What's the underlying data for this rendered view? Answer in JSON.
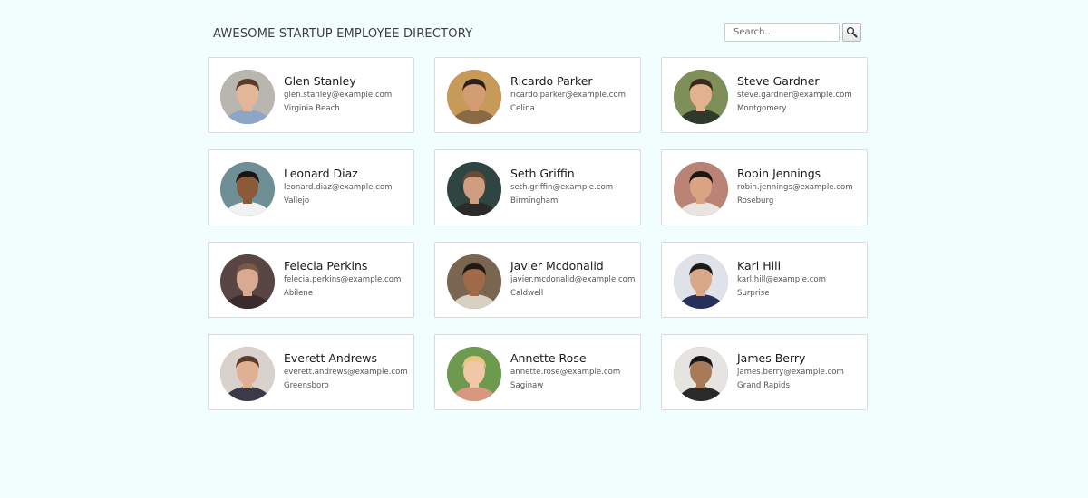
{
  "header": {
    "title": "AWESOME STARTUP EMPLOYEE DIRECTORY",
    "search_placeholder": "Search...",
    "search_value": ""
  },
  "employees": [
    {
      "name": "Glen Stanley",
      "email": "glen.stanley@example.com",
      "city": "Virginia Beach",
      "colors": {
        "bg": "#b9b6b0",
        "skin": "#e3b69a",
        "hair": "#5a3c28",
        "shirt": "#8ea6c6"
      }
    },
    {
      "name": "Ricardo Parker",
      "email": "ricardo.parker@example.com",
      "city": "Celina",
      "colors": {
        "bg": "#c79a5a",
        "skin": "#d49c73",
        "hair": "#2b2119",
        "shirt": "#8a6a45"
      }
    },
    {
      "name": "Steve Gardner",
      "email": "steve.gardner@example.com",
      "city": "Montgomery",
      "colors": {
        "bg": "#7f8f5a",
        "skin": "#e2b190",
        "hair": "#3a2a1e",
        "shirt": "#2f3a2c"
      }
    },
    {
      "name": "Leonard Diaz",
      "email": "leonard.diaz@example.com",
      "city": "Vallejo",
      "colors": {
        "bg": "#6f8f96",
        "skin": "#8a5a3a",
        "hair": "#1a1410",
        "shirt": "#f1f1f1"
      }
    },
    {
      "name": "Seth Griffin",
      "email": "seth.griffin@example.com",
      "city": "Birmingham",
      "colors": {
        "bg": "#2f4542",
        "skin": "#cf9e80",
        "hair": "#6a4a32",
        "shirt": "#2a2a2a"
      }
    },
    {
      "name": "Robin Jennings",
      "email": "robin.jennings@example.com",
      "city": "Roseburg",
      "colors": {
        "bg": "#b98476",
        "skin": "#d8a484",
        "hair": "#1c1512",
        "shirt": "#e9e4e0"
      }
    },
    {
      "name": "Felecia Perkins",
      "email": "felecia.perkins@example.com",
      "city": "Abilene",
      "colors": {
        "bg": "#5a4545",
        "skin": "#d8aa94",
        "hair": "#7a5a46",
        "shirt": "#3a2c2c"
      }
    },
    {
      "name": "Javier Mcdonalid",
      "email": "javier.mcdonalid@example.com",
      "city": "Caldwell",
      "colors": {
        "bg": "#7a6650",
        "skin": "#a06a48",
        "hair": "#211a14",
        "shirt": "#d8d0c0"
      }
    },
    {
      "name": "Karl Hill",
      "email": "karl.hill@example.com",
      "city": "Surprise",
      "colors": {
        "bg": "#dfe2e8",
        "skin": "#d8a888",
        "hair": "#1e1a18",
        "shirt": "#26305a"
      }
    },
    {
      "name": "Everett Andrews",
      "email": "everett.andrews@example.com",
      "city": "Greensboro",
      "colors": {
        "bg": "#d9d2cc",
        "skin": "#e0b094",
        "hair": "#5a3e2a",
        "shirt": "#3a3a4a"
      }
    },
    {
      "name": "Annette Rose",
      "email": "annette.rose@example.com",
      "city": "Saginaw",
      "colors": {
        "bg": "#6e9a50",
        "skin": "#f0c8a8",
        "hair": "#e8c880",
        "shirt": "#d89880"
      }
    },
    {
      "name": "James Berry",
      "email": "james.berry@example.com",
      "city": "Grand Rapids",
      "colors": {
        "bg": "#e6e4e0",
        "skin": "#a87a58",
        "hair": "#1a1614",
        "shirt": "#2a2a2a"
      }
    }
  ]
}
